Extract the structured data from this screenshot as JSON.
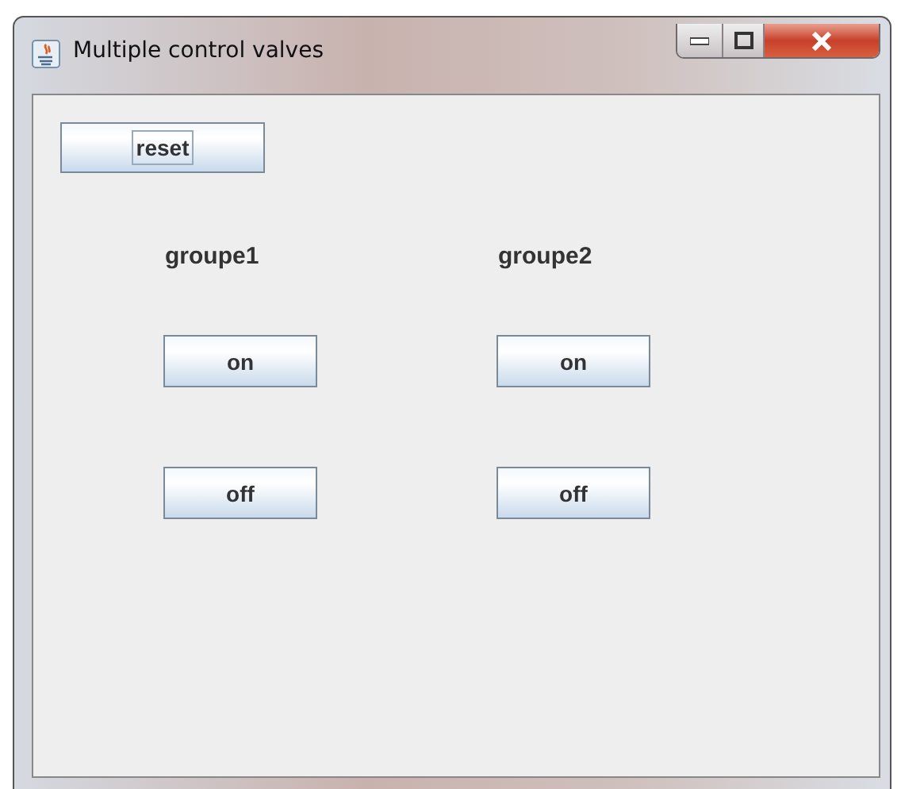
{
  "window": {
    "title": "Multiple control valves"
  },
  "reset_button": {
    "label": "reset",
    "focused": true
  },
  "groups": [
    {
      "label": "groupe1",
      "buttons": [
        "on",
        "off"
      ]
    },
    {
      "label": "groupe2",
      "buttons": [
        "on",
        "off"
      ]
    }
  ]
}
